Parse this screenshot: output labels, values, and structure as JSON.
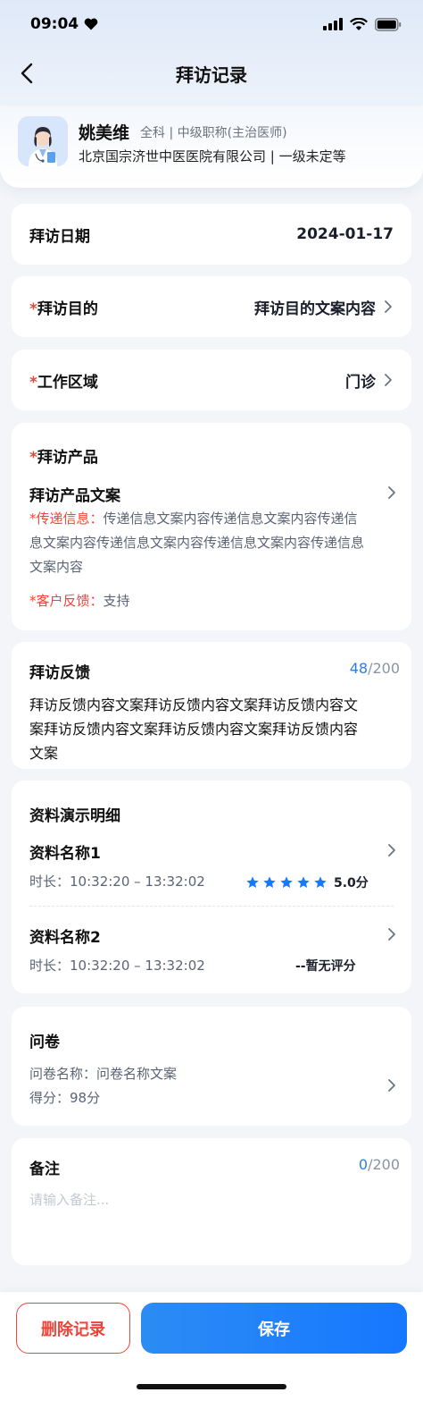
{
  "status_bar": {
    "time": "09:04"
  },
  "nav": {
    "title": "拜访记录"
  },
  "doctor": {
    "name": "姚美维",
    "meta": "全科 | 中级职称(主治医师)",
    "hospital": "北京国宗济世中医医院有限公司 | 一级未定等"
  },
  "visit_date": {
    "label": "拜访日期",
    "value": "2024-01-17"
  },
  "visit_purpose": {
    "required_mark": "*",
    "label": "拜访目的",
    "value": "拜访目的文案内容"
  },
  "work_area": {
    "required_mark": "*",
    "label": "工作区域",
    "value": "门诊"
  },
  "visit_product": {
    "required_mark": "*",
    "label": "拜访产品",
    "product_name": "拜访产品文案",
    "delivery_label": "*传递信息：",
    "delivery_text_line1": "传递信息文案内容传递信息文案内容传递信",
    "delivery_text_line2": "息文案内容传递信息文案内容传递信息文案内容传递信息",
    "delivery_text_line3": "文案内容",
    "feedback_label": "*客户反馈：",
    "feedback_value": "支持"
  },
  "visit_feedback": {
    "label": "拜访反馈",
    "count_current": "48",
    "count_max": "/200",
    "text_line1": "拜访反馈内容文案拜访反馈内容文案拜访反馈内容文",
    "text_line2": "案拜访反馈内容文案拜访反馈内容文案拜访反馈内容",
    "text_line3": "文案"
  },
  "materials": {
    "label": "资料演示明细",
    "items": [
      {
        "name": "资料名称1",
        "duration_label": "时长：",
        "duration": "10:32:20 – 13:32:02",
        "score": "5.0分",
        "rating": 5
      },
      {
        "name": "资料名称2",
        "duration_label": "时长：",
        "duration": "10:32:20 – 13:32:02",
        "score": "--暂无评分"
      }
    ]
  },
  "questionnaire": {
    "label": "问卷",
    "name_line": "问卷名称：问卷名称文案",
    "score_line": "得分：98分"
  },
  "remarks": {
    "label": "备注",
    "count_current": "0",
    "count_max": "/200",
    "placeholder": "请输入备注..."
  },
  "actions": {
    "delete_label": "删除记录",
    "save_label": "保存"
  },
  "colors": {
    "accent": "#1677ff",
    "danger": "#f04438",
    "star": "#1677ff"
  }
}
